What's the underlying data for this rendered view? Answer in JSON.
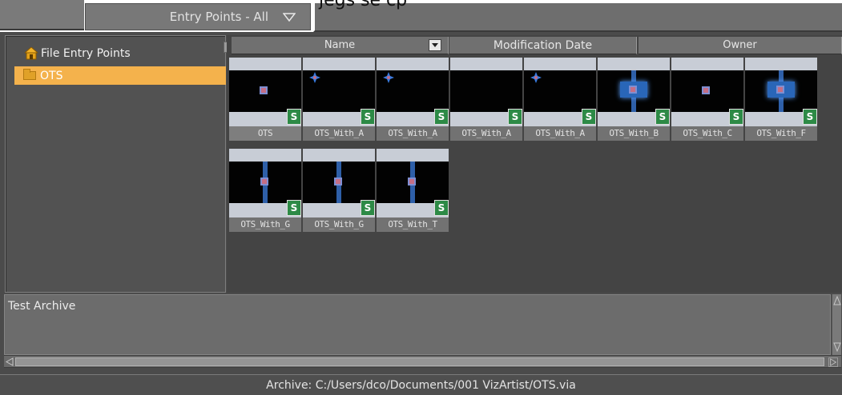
{
  "header": {
    "entry_points_dropdown": "Entry Points - All",
    "cut_off_text": "jegs    se    cp"
  },
  "tree": {
    "root_label": "File Entry Points",
    "items": [
      {
        "label": "OTS",
        "selected": true
      }
    ]
  },
  "columns": {
    "name": "Name",
    "modification_date": "Modification Date",
    "owner": "Owner"
  },
  "scenes": [
    {
      "name": "OTS",
      "badge": "S",
      "art": "dot"
    },
    {
      "name": "OTS_With_A",
      "badge": "S",
      "art": "star-left"
    },
    {
      "name": "OTS_With_A",
      "badge": "S",
      "art": "star-left"
    },
    {
      "name": "OTS_With_A",
      "badge": "S",
      "art": "empty"
    },
    {
      "name": "OTS_With_A",
      "badge": "S",
      "art": "star-left"
    },
    {
      "name": "OTS_With_B",
      "badge": "S",
      "art": "glow"
    },
    {
      "name": "OTS_With_C",
      "badge": "S",
      "art": "dot"
    },
    {
      "name": "OTS_With_F",
      "badge": "S",
      "art": "glow"
    },
    {
      "name": "OTS_With_G",
      "badge": "S",
      "art": "vbar"
    },
    {
      "name": "OTS_With_G",
      "badge": "S",
      "art": "vbar"
    },
    {
      "name": "OTS_With_T",
      "badge": "S",
      "art": "vbar"
    }
  ],
  "description": {
    "text": "Test Archive"
  },
  "status": {
    "archive_path": "Archive: C:/Users/dco/Documents/001 VizArtist/OTS.via"
  },
  "colors": {
    "selection": "#f4b24c",
    "panel": "#525252",
    "badge": "#2d8a46"
  }
}
